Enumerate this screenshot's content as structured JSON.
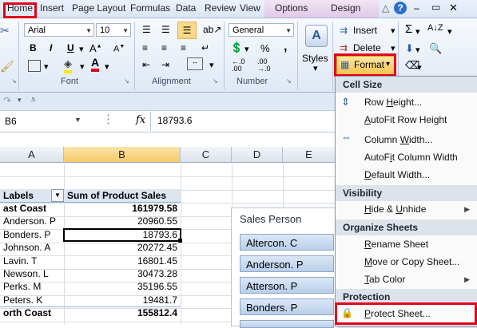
{
  "tabs": {
    "home": "Home",
    "insert": "Insert",
    "page_layout": "Page Layout",
    "formulas": "Formulas",
    "data": "Data",
    "review": "Review",
    "view": "View",
    "options": "Options",
    "design": "Design"
  },
  "ribbon": {
    "font_name": "Arial",
    "font_size": "10",
    "number_format": "General",
    "font_group": "Font",
    "alignment_group": "Alignment",
    "number_group": "Number",
    "styles_label": "Styles",
    "insert_label": "Insert",
    "delete_label": "Delete",
    "format_label": "Format",
    "percent": "%",
    "comma": ","
  },
  "formula_bar": {
    "cell_ref": "B6",
    "fx": "fx",
    "value": "18793.6"
  },
  "columns": [
    "A",
    "B",
    "C",
    "D",
    "E"
  ],
  "table": {
    "header_a": "Labels",
    "header_b": "Sum of Product Sales",
    "rows": [
      {
        "label": "ast Coast",
        "value": "161979.58",
        "bold": true
      },
      {
        "label": "Anderson. P",
        "value": "20960.55"
      },
      {
        "label": "Bonders. P",
        "value": "18793.6"
      },
      {
        "label": "Johnson. A",
        "value": "20272.45"
      },
      {
        "label": "Lavin. T",
        "value": "16801.45"
      },
      {
        "label": "Newson. L",
        "value": "30473.28"
      },
      {
        "label": "Perks. M",
        "value": "35196.55"
      },
      {
        "label": "Peters. K",
        "value": "19481.7"
      },
      {
        "label": "orth Coast",
        "value": "155812.4",
        "bold": true
      }
    ]
  },
  "slicer": {
    "title": "Sales Person",
    "items": [
      "Altercon. C",
      "Anderson. P",
      "Atterson. P",
      "Bonders. P"
    ]
  },
  "menu": {
    "cell_size": "Cell Size",
    "row_height": "Row Height...",
    "autofit_row": "AutoFit Row Height",
    "column_width": "Column Width...",
    "autofit_column": "AutoFit Column Width",
    "default_width": "Default Width...",
    "visibility": "Visibility",
    "hide_unhide": "Hide & Unhide",
    "organize": "Organize Sheets",
    "rename": "Rename Sheet",
    "move_copy": "Move or Copy Sheet...",
    "tab_color": "Tab Color",
    "protection": "Protection",
    "protect_sheet": "Protect Sheet..."
  },
  "colors": {
    "highlight_red": "#e3001b",
    "selected_col": "#f6c86a",
    "ribbon_blue": "#dfe8f5"
  }
}
